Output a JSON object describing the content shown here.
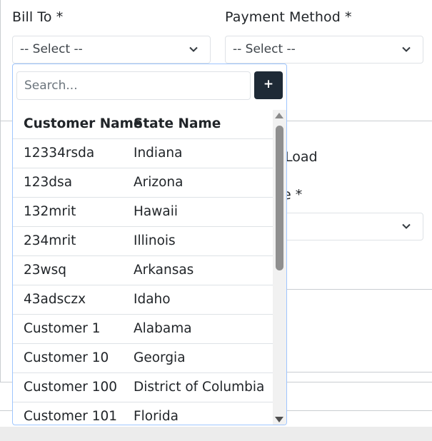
{
  "form": {
    "bill_to_label": "Bill To *",
    "payment_method_label": "Payment Method *",
    "bill_to_value": "-- Select --",
    "payment_method_value": "-- Select --"
  },
  "background": {
    "partial_label_load": "Load",
    "partial_label_required": "e *"
  },
  "dropdown": {
    "search_placeholder": "Search...",
    "add_label": "+",
    "columns": [
      "Customer Name",
      "State Name"
    ],
    "rows": [
      {
        "name": "12334rsda",
        "state": "Indiana"
      },
      {
        "name": "123dsa",
        "state": "Arizona"
      },
      {
        "name": "132mrit",
        "state": "Hawaii"
      },
      {
        "name": "234mrit",
        "state": "Illinois"
      },
      {
        "name": "23wsq",
        "state": "Arkansas"
      },
      {
        "name": "43adsczx",
        "state": "Idaho"
      },
      {
        "name": "Customer 1",
        "state": "Alabama"
      },
      {
        "name": "Customer 10",
        "state": "Georgia"
      },
      {
        "name": "Customer 100",
        "state": "District of Columbia"
      },
      {
        "name": "Customer 101",
        "state": "Florida"
      }
    ]
  },
  "icons": {
    "select_chevron": "chevron-down-icon",
    "scroll_up": "triangle-up-icon",
    "scroll_down": "triangle-down-icon"
  }
}
